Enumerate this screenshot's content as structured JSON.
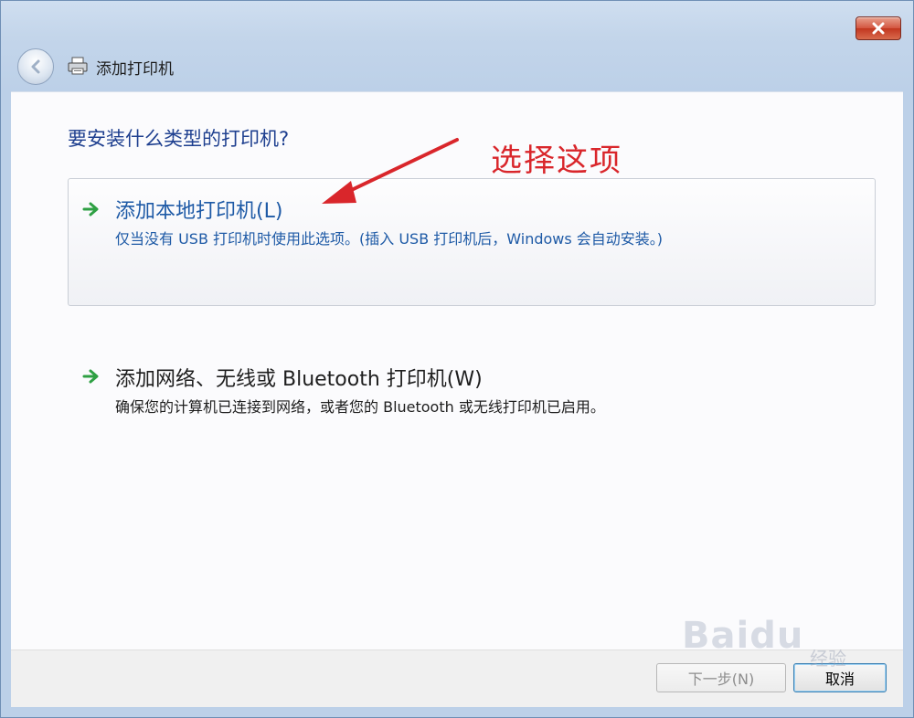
{
  "window": {
    "title": "添加打印机",
    "close_glyph": "✕"
  },
  "main": {
    "question": "要安装什么类型的打印机?",
    "options": [
      {
        "title": "添加本地打印机(L)",
        "description": "仅当没有 USB 打印机时使用此选项。(插入 USB 打印机后，Windows 会自动安装。)",
        "icon": "green-arrow-icon"
      },
      {
        "title": "添加网络、无线或 Bluetooth 打印机(W)",
        "description": "确保您的计算机已连接到网络，或者您的 Bluetooth 或无线打印机已启用。",
        "icon": "green-arrow-icon"
      }
    ]
  },
  "annotation": {
    "text": "选择这项",
    "color": "#d9262b"
  },
  "footer": {
    "next_label": "下一步(N)",
    "cancel_label": "取消"
  },
  "watermark": {
    "text": "Baidu",
    "sub": "经验"
  },
  "colors": {
    "link_blue": "#1e5aa6",
    "heading_blue": "#1e3f8f",
    "arrow_green": "#2ea043"
  }
}
